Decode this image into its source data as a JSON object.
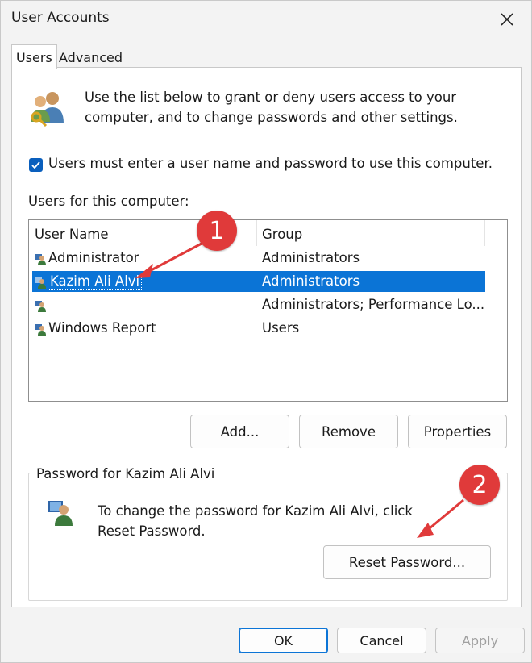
{
  "window": {
    "title": "User Accounts"
  },
  "tabs": [
    {
      "label": "Users"
    },
    {
      "label": "Advanced"
    }
  ],
  "description": "Use the list below to grant or deny users access to your computer, and to change passwords and other settings.",
  "checkbox": {
    "label": "Users must enter a user name and password to use this computer.",
    "checked": true
  },
  "users_label": "Users for this computer:",
  "table": {
    "columns": [
      "User Name",
      "Group"
    ],
    "rows": [
      {
        "name": "Administrator",
        "group": "Administrators"
      },
      {
        "name": "Kazim Ali Alvi",
        "group": "Administrators",
        "selected": true
      },
      {
        "name": "",
        "group": "Administrators; Performance Lo..."
      },
      {
        "name": "Windows Report",
        "group": "Users"
      }
    ]
  },
  "buttons": {
    "add": "Add...",
    "remove": "Remove",
    "properties": "Properties",
    "reset_password": "Reset Password..."
  },
  "password_group": {
    "title": "Password for Kazim Ali Alvi",
    "text": "To change the password for Kazim Ali Alvi, click Reset Password."
  },
  "footer": {
    "ok": "OK",
    "cancel": "Cancel",
    "apply": "Apply"
  },
  "annotations": [
    {
      "label": "1"
    },
    {
      "label": "2"
    }
  ],
  "colors": {
    "accent": "#0b74d6",
    "annotation": "#e03a3a"
  },
  "icons": [
    "close-icon",
    "users-icon",
    "checkmark-icon",
    "user-icon",
    "arrow-annotation"
  ]
}
